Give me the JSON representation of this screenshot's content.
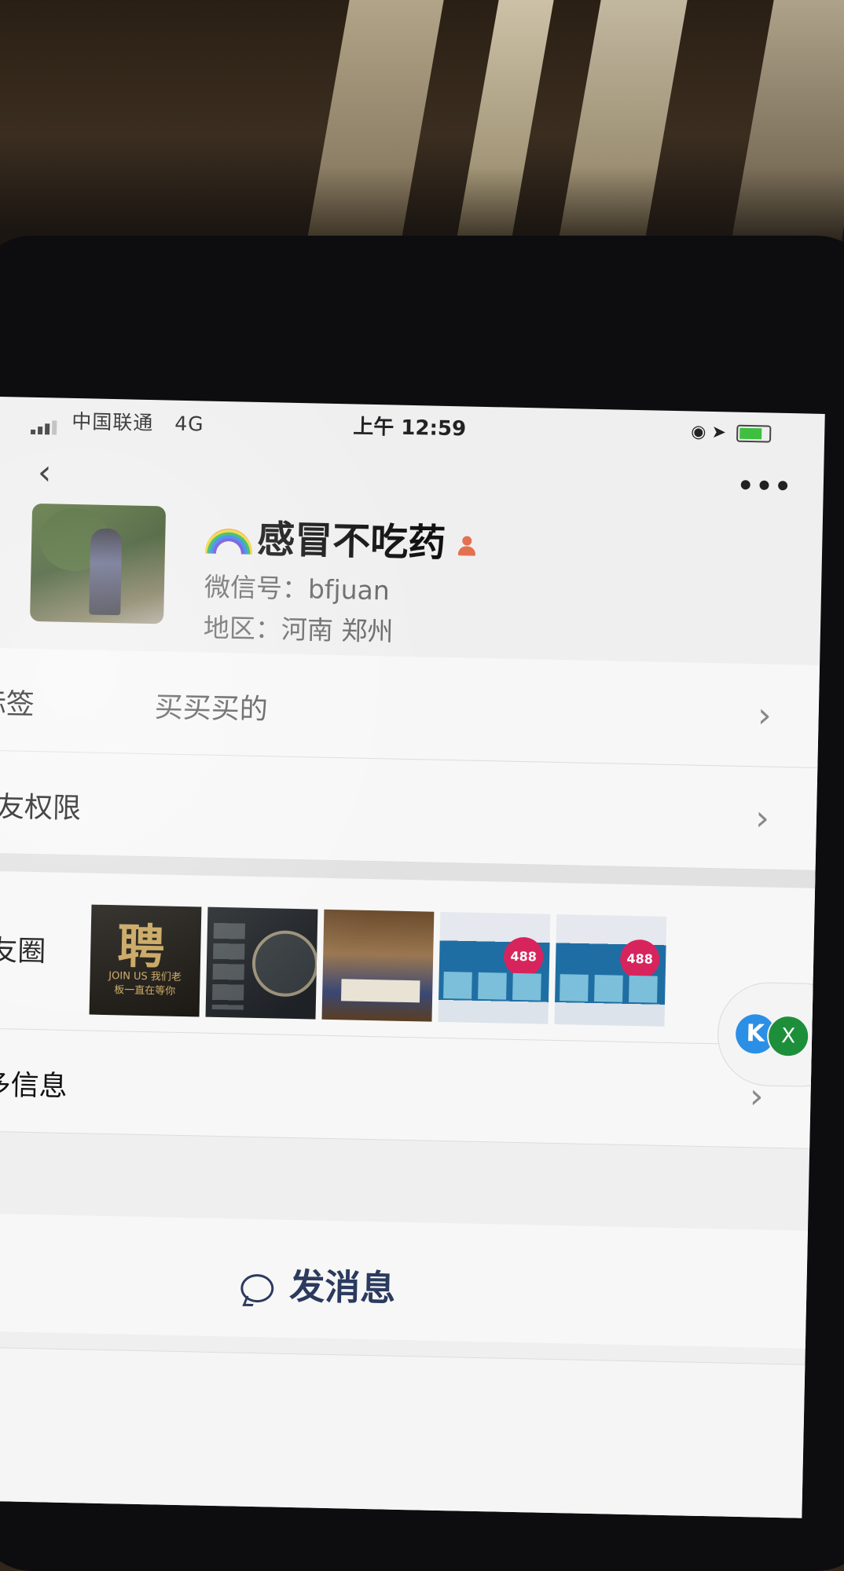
{
  "status_bar": {
    "carrier": "中国联通",
    "network": "4G",
    "time": "上午 12:59"
  },
  "nav": {
    "back_icon": "chevron-left-icon",
    "more_icon": "more-dots-icon",
    "more_text": "•••"
  },
  "profile": {
    "name": "感冒不吃药",
    "wechat_id": "微信号：bfjuan",
    "region": "地区：河南 郑州"
  },
  "rows": {
    "tag_label": "标签",
    "tag_value": "买买买的",
    "permission_label": "朋友权限",
    "moments_label": "朋友圈",
    "more_info_label": "更多信息"
  },
  "moments_thumbnails": {
    "t1_big": "聘",
    "t1_small": "JOIN US 我们老板一直在等你",
    "t4_price": "488",
    "t5_price": "488"
  },
  "floating": {
    "k_icon": "K",
    "x_icon": "X"
  },
  "actions": {
    "send_message": "发消息"
  }
}
